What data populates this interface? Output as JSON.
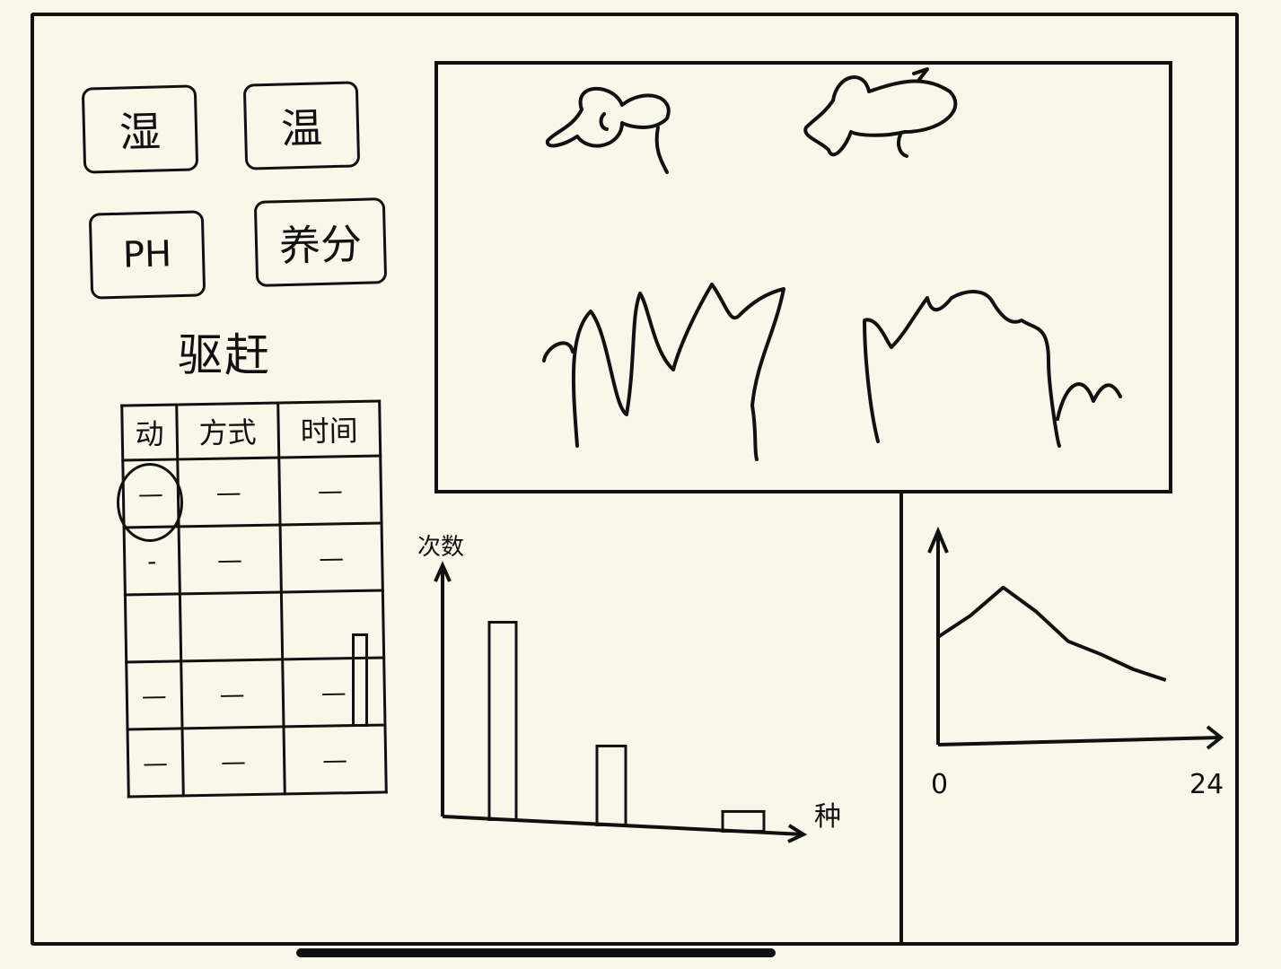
{
  "sensors": [
    {
      "label": "湿",
      "icon": "humidity-icon"
    },
    {
      "label": "温",
      "icon": "temperature-icon"
    },
    {
      "label": "PH",
      "icon": "ph-icon"
    },
    {
      "label": "养分",
      "icon": "nutrient-icon"
    }
  ],
  "drive_section": {
    "title": "驱赶",
    "columns": [
      "动",
      "方式",
      "时间"
    ],
    "rows": [
      [
        "—",
        "—",
        "—"
      ],
      [
        "-",
        "—",
        "—"
      ],
      [
        "",
        "",
        ""
      ],
      [
        "—",
        "—",
        "—"
      ],
      [
        "—",
        "—",
        "—"
      ]
    ]
  },
  "camera_view": {
    "icons": [
      "bird-icon",
      "bird-icon",
      "crop-field-icon"
    ]
  },
  "chart_data": [
    {
      "type": "bar",
      "ylabel": "次数",
      "xlabel": "种",
      "categories": [
        "",
        "",
        ""
      ],
      "values": [
        10,
        4,
        1
      ]
    },
    {
      "type": "line",
      "x_tick_labels": [
        "0",
        "24"
      ],
      "xlim": [
        0,
        24
      ],
      "x": [
        0,
        3,
        6,
        9,
        12,
        15,
        18,
        21
      ],
      "y": [
        5,
        6,
        7.3,
        6.2,
        4.8,
        4.2,
        3.5,
        3
      ]
    }
  ],
  "colors": {
    "background": "#f9f6ea",
    "ink": "#111111"
  }
}
